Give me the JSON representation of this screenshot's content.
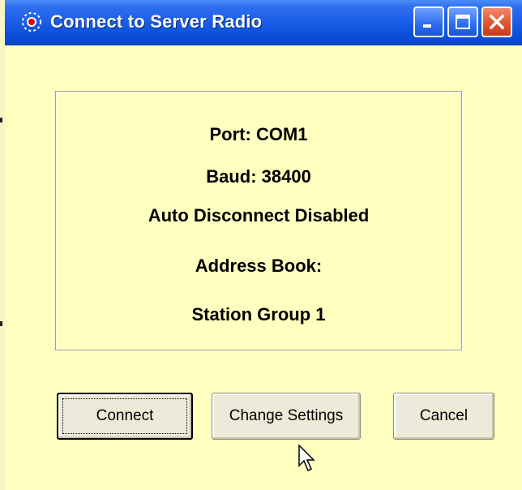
{
  "window": {
    "title": "Connect to Server Radio",
    "icon": "radio-signal-icon",
    "controls": {
      "minimize": "minimize-icon",
      "maximize": "maximize-icon",
      "close": "close-icon"
    }
  },
  "info": {
    "port": "Port: COM1",
    "baud": "Baud: 38400",
    "auto_disconnect": "Auto Disconnect Disabled",
    "address_book_label": "Address Book:",
    "address_book_value": "Station Group 1"
  },
  "buttons": {
    "connect": "Connect",
    "change_settings": "Change Settings",
    "cancel": "Cancel"
  },
  "colors": {
    "background": "#ffffc0",
    "titlebar": "#0a4fd8",
    "close_button": "#e0542e"
  }
}
